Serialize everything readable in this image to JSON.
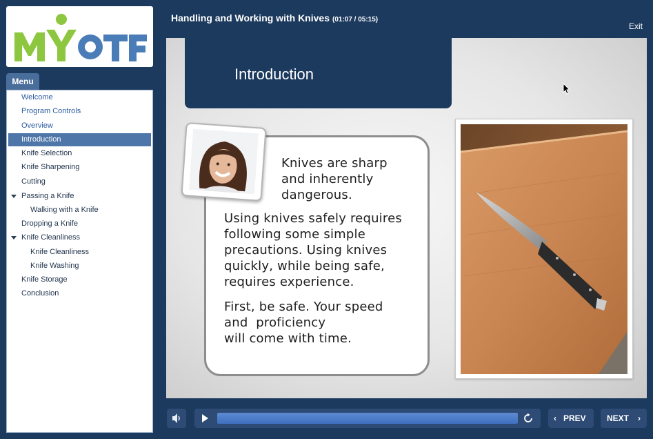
{
  "app": {
    "logo_alt": "MYOTF",
    "course_title": "Handling and Working with Knives",
    "time": "(01:07 / 05:15)",
    "exit_label": "Exit"
  },
  "menu": {
    "tab_label": "Menu",
    "items": [
      {
        "label": "Welcome"
      },
      {
        "label": "Program Controls"
      },
      {
        "label": "Overview"
      },
      {
        "label": "Introduction",
        "active": true
      },
      {
        "label": "Knife Selection"
      },
      {
        "label": "Knife Sharpening"
      },
      {
        "label": "Cutting"
      },
      {
        "label": "Passing a Knife",
        "expanded": true
      },
      {
        "label": "Walking with a Knife"
      },
      {
        "label": "Dropping a Knife"
      },
      {
        "label": "Knife Cleanliness",
        "expanded": true
      },
      {
        "label": "Knife Cleanliness"
      },
      {
        "label": "Knife Washing"
      },
      {
        "label": "Knife Storage"
      },
      {
        "label": "Conclusion"
      }
    ]
  },
  "slide": {
    "heading": "Introduction",
    "bubble_para1": "Knives are sharp\nand inherently\ndangerous.",
    "bubble_para2": "Using knives safely requires\nfollowing some simple\nprecautions. Using knives\nquickly, while being safe,\nrequires experience.",
    "bubble_para3": "First, be safe. Your speed\nand  proficiency\nwill come with time."
  },
  "controls": {
    "volume_icon": "speaker-icon",
    "play_icon": "play-icon",
    "replay_icon": "replay-icon",
    "progress_fraction": 1.0,
    "prev_label": "PREV",
    "next_label": "NEXT"
  },
  "colors": {
    "background": "#1c3a5e",
    "menu_active": "#4f76a8",
    "progress": "#4a78c6",
    "logo_green": "#8dc63f",
    "logo_blue": "#4a7cb8"
  }
}
